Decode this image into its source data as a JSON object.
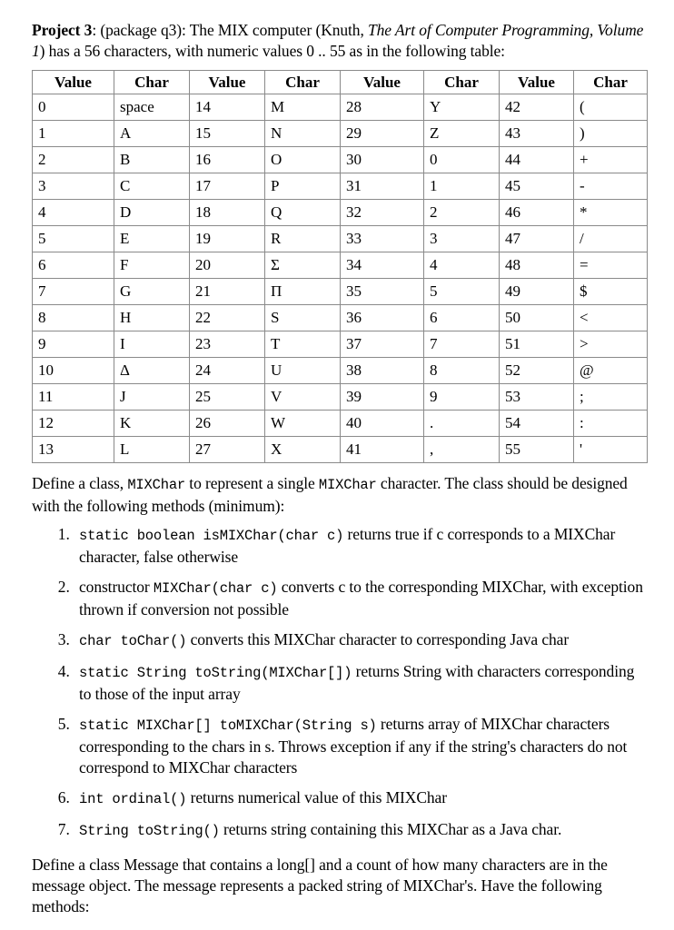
{
  "document": {
    "intro": {
      "label_bold": "Project 3",
      "text_1": ": (package q3): The MIX computer (Knuth, ",
      "italic_1": "The Art of Computer Programming, Volume 1",
      "text_2": ") has a 56 characters, with numeric values 0 .. 55 as in the following table:"
    },
    "table": {
      "headers": [
        "Value",
        "Char",
        "Value",
        "Char",
        "Value",
        "Char",
        "Value",
        "Char"
      ],
      "rows": [
        [
          "0",
          "space",
          "14",
          "M",
          "28",
          "Y",
          "42",
          "("
        ],
        [
          "1",
          "A",
          "15",
          "N",
          "29",
          "Z",
          "43",
          ")"
        ],
        [
          "2",
          "B",
          "16",
          "O",
          "30",
          "0",
          "44",
          "+"
        ],
        [
          "3",
          "C",
          "17",
          "P",
          "31",
          "1",
          "45",
          "-"
        ],
        [
          "4",
          "D",
          "18",
          "Q",
          "32",
          "2",
          "46",
          "*"
        ],
        [
          "5",
          "E",
          "19",
          "R",
          "33",
          "3",
          "47",
          "/"
        ],
        [
          "6",
          "F",
          "20",
          "Σ",
          "34",
          "4",
          "48",
          "="
        ],
        [
          "7",
          "G",
          "21",
          "Π",
          "35",
          "5",
          "49",
          "$"
        ],
        [
          "8",
          "H",
          "22",
          "S",
          "36",
          "6",
          "50",
          "<"
        ],
        [
          "9",
          "I",
          "23",
          "T",
          "37",
          "7",
          "51",
          ">"
        ],
        [
          "10",
          "Δ",
          "24",
          "U",
          "38",
          "8",
          "52",
          "@"
        ],
        [
          "11",
          "J",
          "25",
          "V",
          "39",
          "9",
          "53",
          ";"
        ],
        [
          "12",
          "K",
          "26",
          "W",
          "40",
          ".",
          "54",
          ":"
        ],
        [
          "13",
          "L",
          "27",
          "X",
          "41",
          ",",
          "55",
          "'"
        ]
      ]
    },
    "define_para": {
      "part_1": "Define a class, ",
      "code_1": "MIXChar",
      "part_2": " to represent a single ",
      "code_2": "MIXChar",
      "part_3": " character.  The class should be designed with the following methods (minimum):"
    },
    "methods": [
      {
        "code": "static boolean isMIXChar(char c)",
        "text": " returns true if c corresponds to a MIXChar character, false otherwise"
      },
      {
        "pre": "constructor ",
        "code": "MIXChar(char c)",
        "text": " converts c to the corresponding MIXChar, with exception thrown if conversion not possible"
      },
      {
        "code": "char toChar()",
        "text": " converts this MIXChar character to corresponding Java char"
      },
      {
        "code": "static String toString(MIXChar[])",
        "text": " returns String with characters corresponding to those of the input array"
      },
      {
        "code": "static MIXChar[] toMIXChar(String s)",
        "text": " returns array of MIXChar characters corresponding to the chars in s.  Throws exception if any if the string's characters do not correspond to MIXChar characters"
      },
      {
        "code": "int ordinal()",
        "text": " returns numerical value of this MIXChar"
      },
      {
        "code": "String toString()",
        "text": " returns string containing this MIXChar as a Java char."
      }
    ],
    "message_para": "Define a class Message that contains a long[] and a count of how many characters are in the message object.  The message represents a packed string of MIXChar's.  Have the following methods:"
  }
}
